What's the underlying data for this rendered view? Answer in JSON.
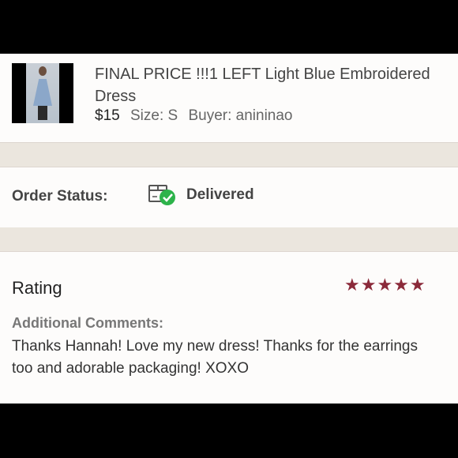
{
  "item": {
    "title": "FINAL PRICE !!!1 LEFT Light Blue Embroidered Dress",
    "price": "$15",
    "size": "Size: S",
    "buyer": "Buyer: anininao"
  },
  "status": {
    "label": "Order Status:",
    "value": "Delivered",
    "icon": "package-delivered-icon"
  },
  "rating": {
    "title": "Rating",
    "stars": 5,
    "stars_display": "★★★★★",
    "star_color": "#8b2a3a"
  },
  "comments": {
    "label": "Additional Comments:",
    "text": "Thanks Hannah! Love my new dress! Thanks for the earrings too and adorable packaging! XOXO"
  },
  "colors": {
    "background_band": "#000000",
    "card": "#fdfcfb",
    "separator": "#ebe6de",
    "check_green": "#2db34a"
  }
}
